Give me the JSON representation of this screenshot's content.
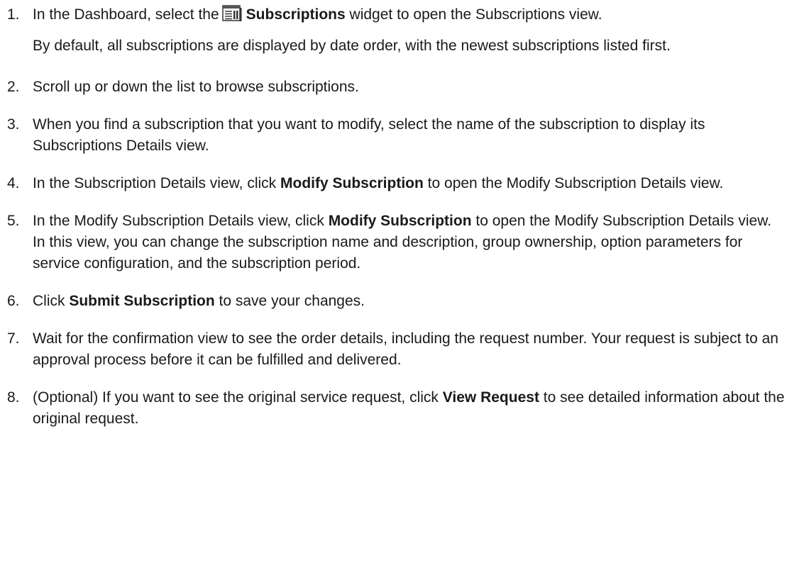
{
  "steps": [
    {
      "number": "1.",
      "pre": "In the Dashboard, select the",
      "icon": "subscriptions-widget-icon",
      "bold": "Subscriptions",
      "post": "widget to open the Subscriptions view.",
      "note": "By default, all subscriptions are displayed by date order, with the newest subscriptions listed first."
    },
    {
      "number": "2.",
      "text": "Scroll up or down the list to browse subscriptions."
    },
    {
      "number": "3.",
      "text": "When you find a subscription that you want to modify, select the name of the subscription to display its Subscriptions Details view."
    },
    {
      "number": "4.",
      "pre": "In the Subscription Details view, click",
      "bold": "Modify Subscription",
      "post": "to open the Modify Subscription Details view."
    },
    {
      "number": "5.",
      "pre": "In the Modify Subscription Details view, click",
      "bold": "Modify Subscription",
      "post": "to open the Modify Subscription Details view. In this view, you can change the subscription name and description, group ownership, option parameters for service configuration, and the subscription period."
    },
    {
      "number": "6.",
      "pre": "Click",
      "bold": "Submit Subscription",
      "post": "to save your changes."
    },
    {
      "number": "7.",
      "text": "Wait for the confirmation view to see the order details, including the request number. Your request is subject to an approval process before it can be fulfilled and delivered."
    },
    {
      "number": "8.",
      "pre": "(Optional) If you want to see the original service request, click",
      "bold": "View Request",
      "post": "to see detailed information about the original request."
    }
  ]
}
